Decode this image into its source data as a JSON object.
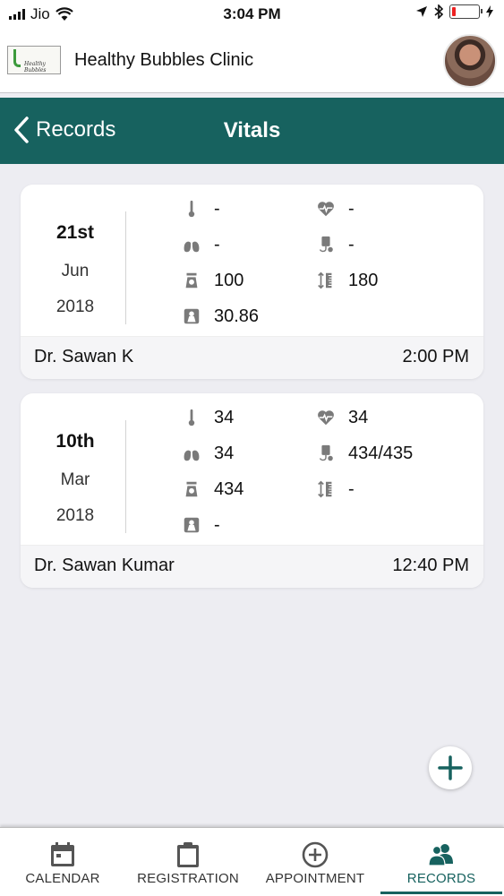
{
  "status_bar": {
    "carrier": "Jio",
    "time": "3:04 PM"
  },
  "header": {
    "clinic_name": "Healthy Bubbles Clinic",
    "logo_text": "Healthy Bubbles"
  },
  "nav": {
    "back_label": "Records",
    "title": "Vitals"
  },
  "records": [
    {
      "day": "21st",
      "month": "Jun",
      "year": "2018",
      "temperature": "-",
      "heart_rate": "-",
      "respiration": "-",
      "blood_pressure": "-",
      "weight": "100",
      "height": "180",
      "bmi": "30.86",
      "doctor": "Dr. Sawan K",
      "time": "2:00 PM"
    },
    {
      "day": "10th",
      "month": "Mar",
      "year": "2018",
      "temperature": "34",
      "heart_rate": "34",
      "respiration": "34",
      "blood_pressure": "434/435",
      "weight": "434",
      "height": "-",
      "bmi": "-",
      "doctor": "Dr. Sawan Kumar",
      "time": "12:40 PM"
    }
  ],
  "tabs": [
    {
      "label": "CALENDAR",
      "icon": "calendar-icon"
    },
    {
      "label": "REGISTRATION",
      "icon": "clipboard-icon"
    },
    {
      "label": "APPOINTMENT",
      "icon": "plus-circle-icon"
    },
    {
      "label": "RECORDS",
      "icon": "users-icon",
      "active": true
    }
  ],
  "colors": {
    "primary": "#17625f",
    "background": "#ededf2",
    "icon_gray": "#7a7a7a"
  }
}
